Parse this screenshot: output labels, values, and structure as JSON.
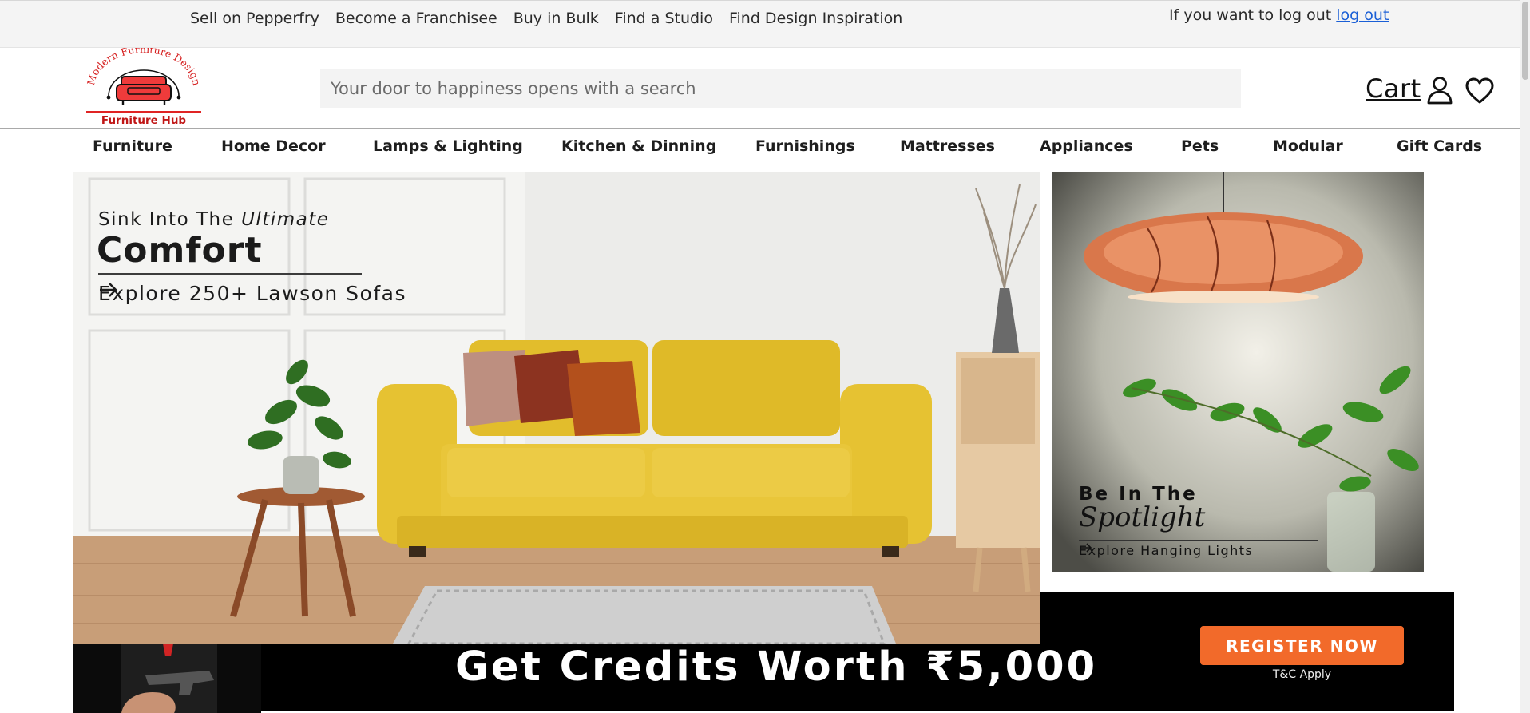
{
  "topbar": {
    "links": [
      "Sell on Pepperfry",
      "Become a Franchisee",
      "Buy in Bulk",
      "Find a Studio",
      "Find Design Inspiration"
    ],
    "logout_text": "If you want to log out",
    "logout_link": "log out"
  },
  "header": {
    "logo_arc_text": "Modern Furniture Design",
    "logo_name": "Furniture Hub",
    "search_placeholder": "Your door to happiness opens with a search",
    "cart_label": "Cart",
    "icons": [
      "user-icon",
      "heart-icon"
    ]
  },
  "categories": [
    "Furniture",
    "Home Decor",
    "Lamps & Lighting",
    "Kitchen & Dinning",
    "Furnishings",
    "Mattresses",
    "Appliances",
    "Pets",
    "Modular",
    "Gift Cards"
  ],
  "hero": {
    "kicker_prefix": "Sink Into The",
    "kicker_em": "Ultimate",
    "title": "Comfort",
    "cta": "Explore 250+ Lawson Sofas"
  },
  "side_banner": {
    "kicker": "Be In The",
    "script": "Spotlight",
    "cta": "Explore Hanging Lights"
  },
  "promo": {
    "title": "Get Credits Worth ₹5,000",
    "button": "REGISTER NOW",
    "note": "T&C Apply"
  },
  "colors": {
    "accent_orange": "#f26a2a",
    "sofa_yellow": "#e6c232",
    "link_blue": "#1a5fd6",
    "logo_red": "#e02424"
  }
}
